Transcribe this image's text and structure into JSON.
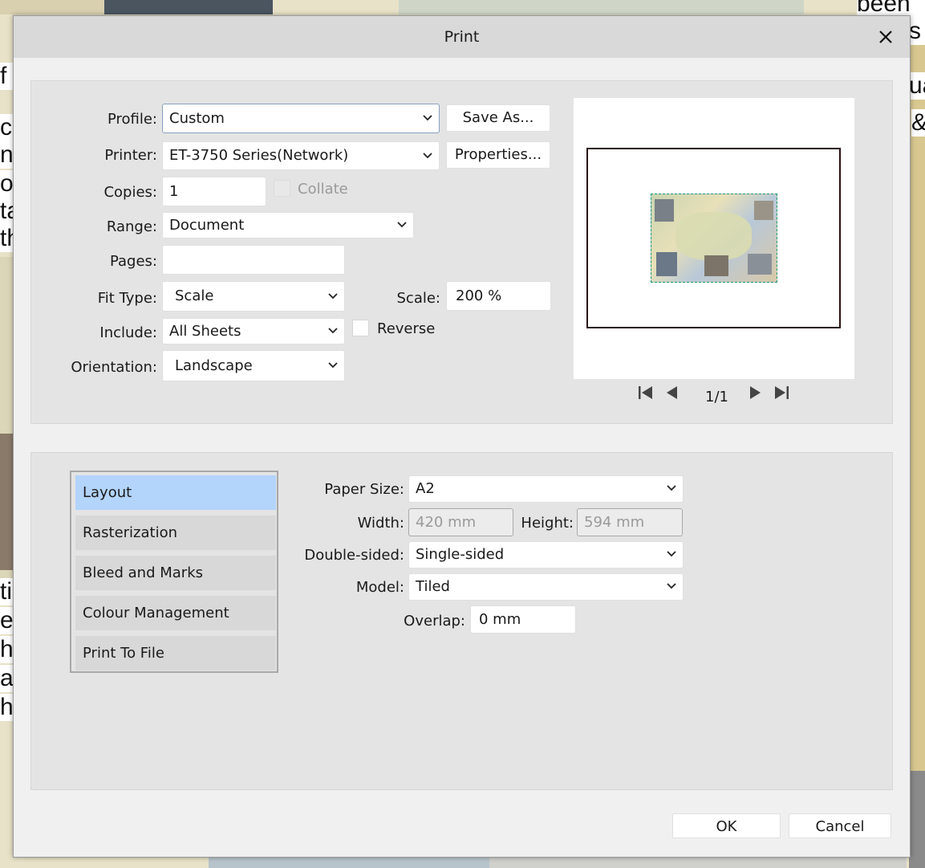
{
  "background": {
    "fragments": [
      "been",
      "s",
      "f",
      "ua",
      "&",
      "ca",
      "n",
      "o",
      "ta",
      "th",
      "ti",
      "er",
      "h",
      "ar",
      "h"
    ]
  },
  "dialog": {
    "title": "Print",
    "close_glyph": "✕"
  },
  "general": {
    "profile": {
      "label": "Profile:",
      "value": "Custom"
    },
    "save_as": "Save As...",
    "printer": {
      "label": "Printer:",
      "value": "ET-3750 Series(Network)"
    },
    "properties": "Properties...",
    "copies": {
      "label": "Copies:",
      "value": "1"
    },
    "collate": "Collate",
    "range": {
      "label": "Range:",
      "value": "Document"
    },
    "pages": {
      "label": "Pages:",
      "value": ""
    },
    "fit_type": {
      "label": "Fit Type:",
      "value": "Scale"
    },
    "scale": {
      "label": "Scale:",
      "value": "200 %"
    },
    "include": {
      "label": "Include:",
      "value": "All Sheets"
    },
    "reverse": "Reverse",
    "orientation": {
      "label": "Orientation:",
      "value": "Landscape"
    }
  },
  "preview": {
    "page_indicator": "1/1"
  },
  "tabs": [
    {
      "label": "Layout",
      "active": true
    },
    {
      "label": "Rasterization",
      "active": false
    },
    {
      "label": "Bleed and Marks",
      "active": false
    },
    {
      "label": "Colour Management",
      "active": false
    },
    {
      "label": "Print To File",
      "active": false
    }
  ],
  "layout": {
    "paper_size": {
      "label": "Paper Size:",
      "value": "A2"
    },
    "width": {
      "label": "Width:",
      "value": "420 mm"
    },
    "height": {
      "label": "Height:",
      "value": "594 mm"
    },
    "double_sided": {
      "label": "Double-sided:",
      "value": "Single-sided"
    },
    "model": {
      "label": "Model:",
      "value": "Tiled"
    },
    "overlap": {
      "label": "Overlap:",
      "value": "0 mm"
    }
  },
  "footer": {
    "ok": "OK",
    "cancel": "Cancel"
  },
  "colors": {
    "accent_tab": "#b3d4fb",
    "panel": "#e4e4e4",
    "titlebar": "#d9d9d9"
  }
}
